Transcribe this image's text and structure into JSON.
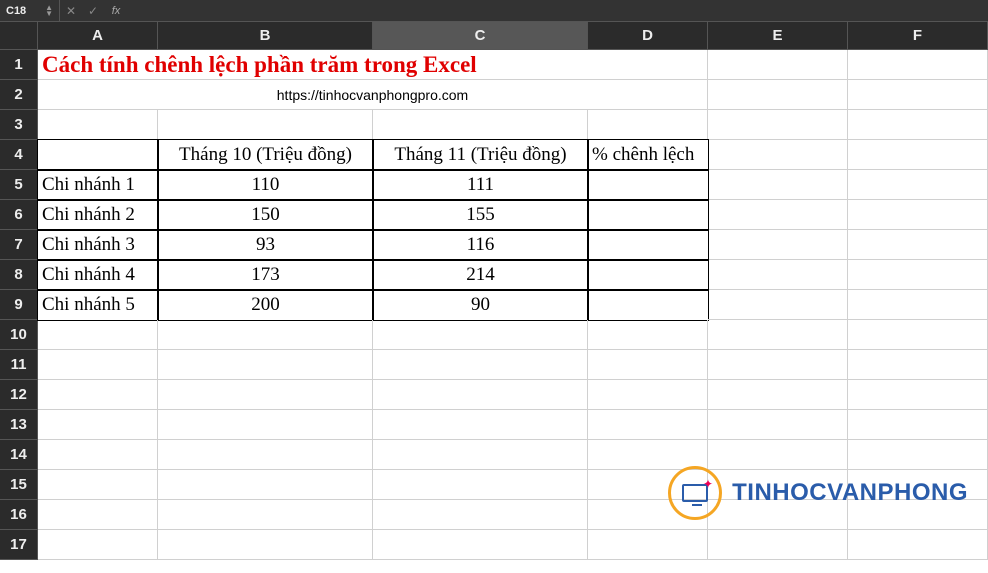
{
  "formula_bar": {
    "cell_ref": "C18",
    "cancel": "✕",
    "confirm": "✓",
    "fx": "fx",
    "value": ""
  },
  "columns": [
    "A",
    "B",
    "C",
    "D",
    "E",
    "F"
  ],
  "selected_col": "C",
  "rows": [
    "1",
    "2",
    "3",
    "4",
    "5",
    "6",
    "7",
    "8",
    "9",
    "10",
    "11",
    "12",
    "13",
    "14",
    "15",
    "16",
    "17"
  ],
  "title": "Cách tính chênh lệch phần trăm trong Excel",
  "subtitle": "https://tinhocvanphongpro.com",
  "table": {
    "headers": {
      "b": "Tháng 10 (Triệu đồng)",
      "c": "Tháng 11 (Triệu đồng)",
      "d": "% chênh lệch"
    },
    "rows": [
      {
        "a": "Chi nhánh 1",
        "b": "110",
        "c": "111",
        "d": ""
      },
      {
        "a": "Chi nhánh 2",
        "b": "150",
        "c": "155",
        "d": ""
      },
      {
        "a": "Chi nhánh 3",
        "b": "93",
        "c": "116",
        "d": ""
      },
      {
        "a": "Chi nhánh 4",
        "b": "173",
        "c": "214",
        "d": ""
      },
      {
        "a": "Chi nhánh 5",
        "b": "200",
        "c": "90",
        "d": ""
      }
    ]
  },
  "watermark": "TINHOCVANPHONG",
  "chart_data": {
    "type": "table",
    "title": "Cách tính chênh lệch phần trăm trong Excel",
    "columns": [
      "",
      "Tháng 10 (Triệu đồng)",
      "Tháng 11 (Triệu đồng)",
      "% chênh lệch"
    ],
    "rows": [
      [
        "Chi nhánh 1",
        110,
        111,
        null
      ],
      [
        "Chi nhánh 2",
        150,
        155,
        null
      ],
      [
        "Chi nhánh 3",
        93,
        116,
        null
      ],
      [
        "Chi nhánh 4",
        173,
        214,
        null
      ],
      [
        "Chi nhánh 5",
        200,
        90,
        null
      ]
    ]
  }
}
